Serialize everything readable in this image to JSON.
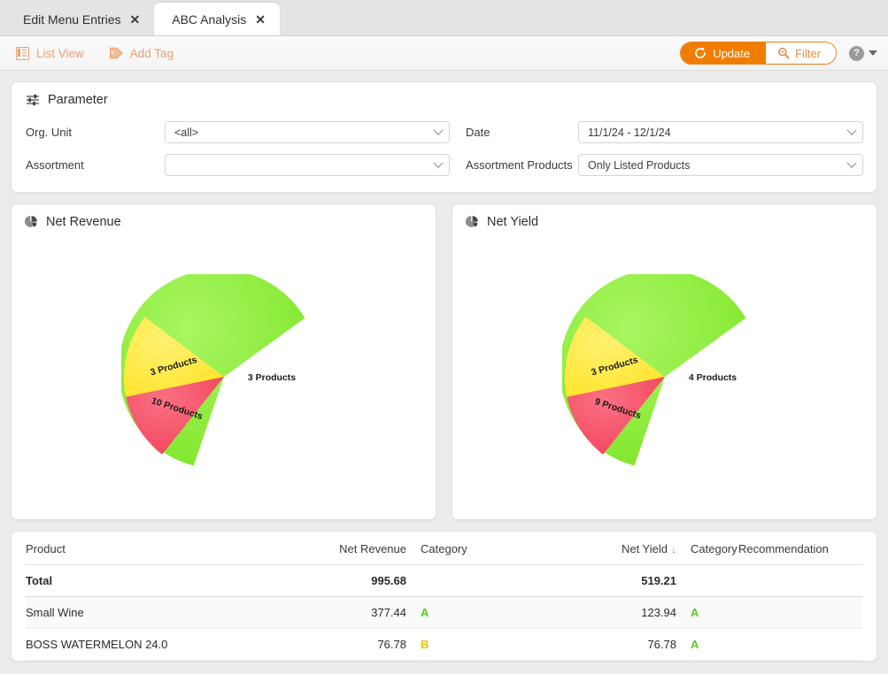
{
  "tabs": [
    {
      "label": "Edit Menu Entries",
      "active": false,
      "close": "✕"
    },
    {
      "label": "ABC Analysis",
      "active": true,
      "close": "✕"
    }
  ],
  "toolbar": {
    "list_view_label": "List View",
    "add_tag_label": "Add Tag",
    "update_label": "Update",
    "filter_label": "Filter",
    "help_label": "?",
    "accent_orange": "#f07d00",
    "muted_orange": "#e9a070"
  },
  "parameter": {
    "title": "Parameter",
    "fields": [
      {
        "label": "Org. Unit",
        "value": "<all>"
      },
      {
        "label": "Date",
        "value": "11/1/24 - 12/1/24"
      },
      {
        "label": "Assortment",
        "value": ""
      },
      {
        "label": "Assortment Products",
        "value": "Only Listed Products"
      }
    ]
  },
  "charts": [
    {
      "title": "Net Revenue",
      "chart_data": {
        "type": "pie",
        "title": "Net Revenue",
        "labels": [
          "3 Products",
          "3 Products",
          "10 Products"
        ],
        "values": [
          80,
          13,
          7
        ],
        "colors": [
          "#8fee3c",
          "#ffe838",
          "#f4536a"
        ],
        "legend": "none",
        "data_labels_on_slices": true
      }
    },
    {
      "title": "Net Yield",
      "chart_data": {
        "type": "pie",
        "title": "Net Yield",
        "labels": [
          "4 Products",
          "3 Products",
          "9 Products"
        ],
        "values": [
          80,
          13,
          7
        ],
        "colors": [
          "#8fee3c",
          "#ffe838",
          "#f4536a"
        ],
        "legend": "none",
        "data_labels_on_slices": true
      }
    }
  ],
  "table": {
    "columns": [
      "Product",
      "Net Revenue",
      "Category",
      "Net Yield",
      "Category",
      "Recommendation"
    ],
    "sorted_column": "Net Yield",
    "sort_direction": "↓",
    "rows": [
      {
        "product": "Total",
        "net_revenue": "995.68",
        "category_revenue": "",
        "net_yield": "519.21",
        "category_yield": "",
        "recommendation": "",
        "is_total": true
      },
      {
        "product": "Small Wine",
        "net_revenue": "377.44",
        "category_revenue": "A",
        "net_yield": "123.94",
        "category_yield": "A",
        "recommendation": "",
        "is_total": false
      },
      {
        "product": "BOSS WATERMELON 24.0",
        "net_revenue": "76.78",
        "category_revenue": "B",
        "net_yield": "76.78",
        "category_yield": "A",
        "recommendation": "",
        "is_total": false
      }
    ]
  }
}
